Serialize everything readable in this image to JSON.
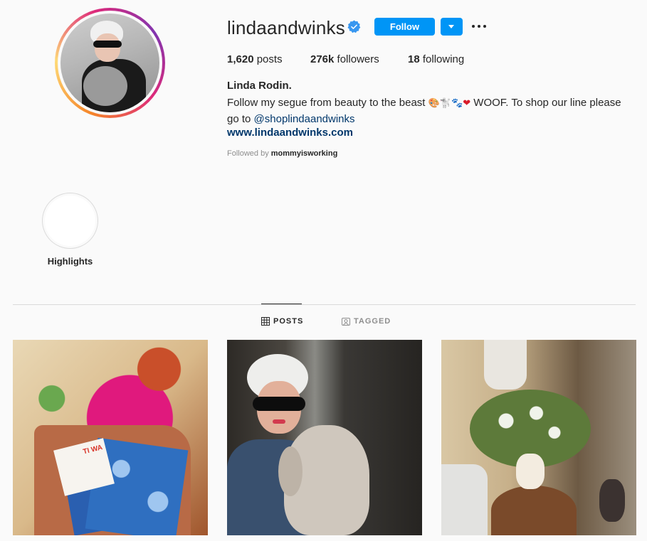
{
  "profile": {
    "username": "lindaandwinks",
    "follow_label": "Follow",
    "stats": {
      "posts_count": "1,620",
      "posts_label": "posts",
      "followers_count": "276k",
      "followers_label": "followers",
      "following_count": "18",
      "following_label": "following"
    },
    "full_name": "Linda Rodin.",
    "bio_text_1": "Follow my segue from beauty to the beast ",
    "bio_emoji_1": "🎨",
    "bio_emoji_2": "🐩",
    "bio_emoji_3": "🐾",
    "bio_emoji_4": "❤",
    "bio_text_2": " WOOF. To shop our line please go to ",
    "bio_mention": "@shoplindaandwinks",
    "website": "www.lindaandwinks.com",
    "followed_by_prefix": "Followed by ",
    "followed_by_user": "mommyisworking"
  },
  "highlights": {
    "label": "Highlights"
  },
  "tabs": {
    "posts": "POSTS",
    "tagged": "TAGGED"
  },
  "posts_grid": {
    "tile_1_card_text": "TI WA"
  },
  "colors": {
    "accent": "#0095f6",
    "link": "#00376b",
    "background": "#fafafa",
    "muted": "#8e8e8e"
  },
  "icons": [
    "verified-badge-icon",
    "chevron-down-icon",
    "more-options-icon",
    "grid-icon",
    "tagged-icon"
  ]
}
